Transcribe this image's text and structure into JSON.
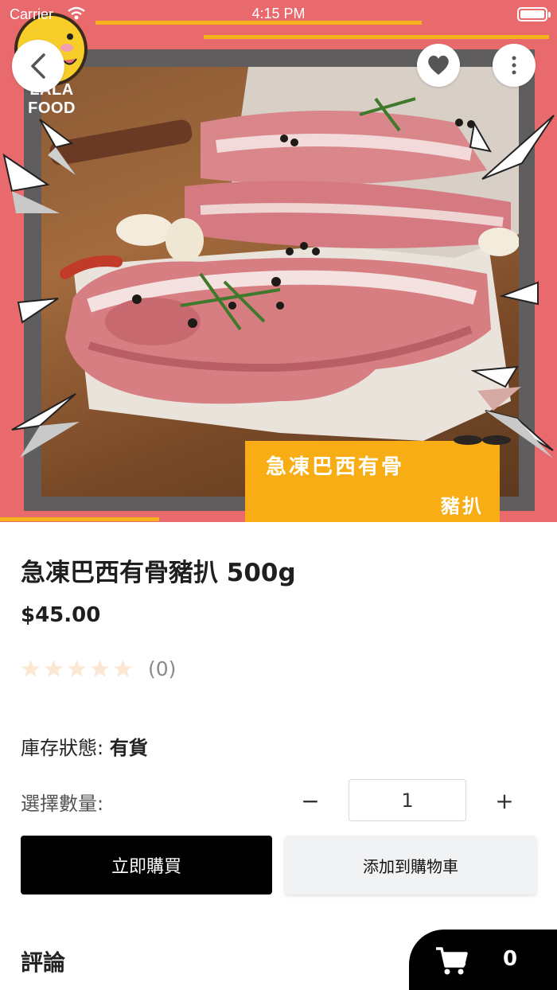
{
  "status_bar": {
    "carrier": "Carrier",
    "time": "4:15 PM"
  },
  "brand": {
    "logo_text": "LALA FOOD"
  },
  "hero": {
    "label_line1": "急凍巴西有骨",
    "label_line2": "豬扒",
    "background_color": "#e96a6c",
    "label_color": "#f9ad14"
  },
  "product": {
    "title": "急凍巴西有骨豬扒 500g",
    "price": "$45.00",
    "rating_stars": 0,
    "rating_count": "(0)",
    "stock_label": "庫存狀態:",
    "stock_value": "有貨",
    "quantity_label": "選擇數量:",
    "quantity_minus": "−",
    "quantity_value": "1",
    "quantity_plus": "+"
  },
  "actions": {
    "buy_now": "立即購買",
    "add_to_cart": "添加到購物車"
  },
  "reviews": {
    "title": "評論"
  },
  "cart": {
    "count": "0"
  },
  "icons": {
    "back": "chevron-left-icon",
    "favorite": "heart-icon",
    "more": "more-vertical-icon",
    "cart": "shopping-cart-icon"
  }
}
